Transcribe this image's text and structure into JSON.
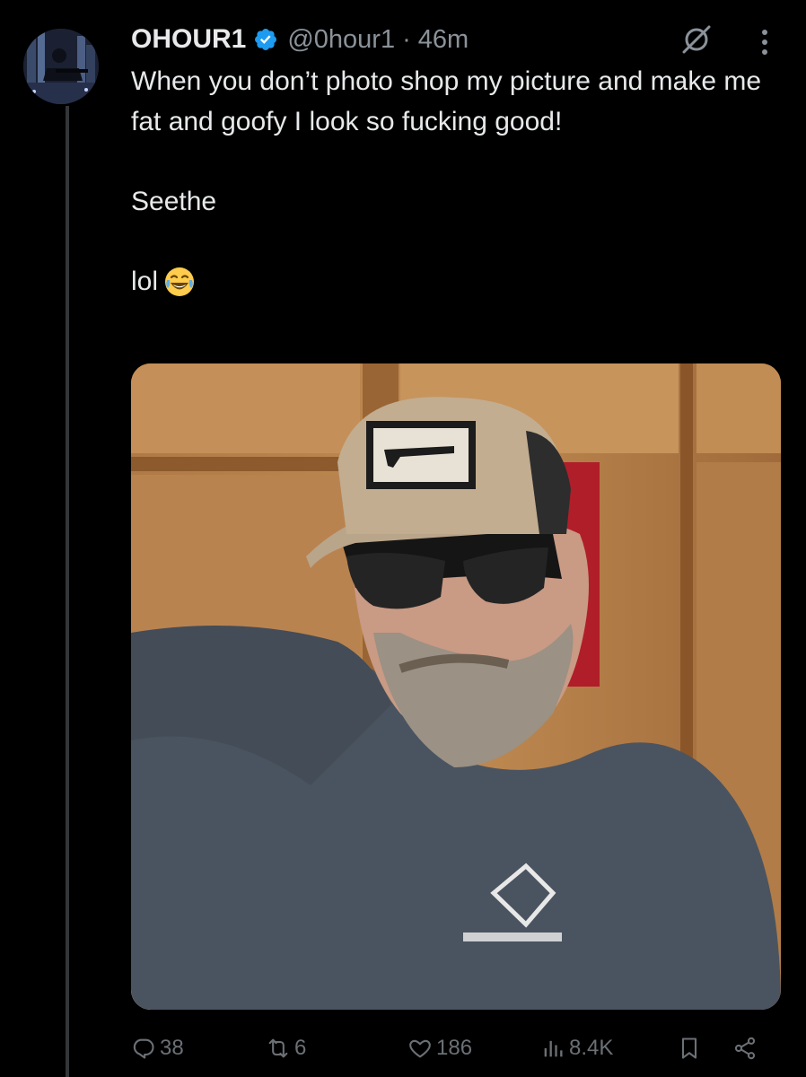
{
  "tweet": {
    "display_name": "OHOUR1",
    "handle": "@0hour1",
    "separator": "·",
    "time": "46m",
    "verified": true,
    "text_lines": [
      "When you don’t photo shop my picture and make me fat and goofy I look so fucking good!",
      "Seethe",
      "lol"
    ],
    "emoji": "face-with-tears-of-joy"
  },
  "actions": {
    "replies": "38",
    "retweets": "6",
    "likes": "186",
    "views": "8.4K"
  },
  "colors": {
    "background": "#000000",
    "text": "#e7e9ea",
    "muted": "#8b9299",
    "verified": "#1d9bf0",
    "thread_line": "#333639"
  },
  "icons": [
    "verified-badge-icon",
    "grok-icon",
    "more-icon",
    "reply-icon",
    "retweet-icon",
    "like-icon",
    "views-icon",
    "bookmark-icon",
    "share-icon"
  ]
}
